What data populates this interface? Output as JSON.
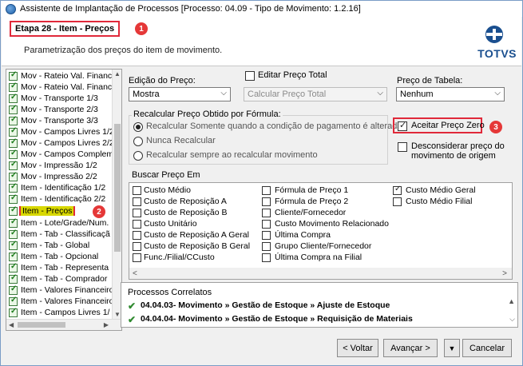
{
  "window": {
    "title": "Assistente de Implantação de Processos [Processo: 04.09 - Tipo de Movimento: 1.2.16]"
  },
  "header": {
    "step_title": "Etapa 28 - Item - Preços",
    "subtitle": "Parametrização dos preços do item de movimento.",
    "badge1": "1",
    "logo_text": "TOTVS"
  },
  "tree": {
    "items": [
      "Mov - Rateio Val. Financ",
      "Mov - Rateio Val. Financ",
      "Mov - Transporte 1/3",
      "Mov - Transporte 2/3",
      "Mov - Transporte 3/3",
      "Mov - Campos Livres 1/2",
      "Mov - Campos Livres 2/2",
      "Mov - Campos Compleme",
      "Mov - Impressão 1/2",
      "Mov - Impressão 2/2",
      "Item - Identificação 1/2",
      "Item - Identificação 2/2",
      "Item - Preços",
      "Item - Lote/Grade/Num.",
      "Item - Tab - Classificaçã",
      "Item - Tab - Global",
      "Item - Tab - Opcional",
      "Item - Tab - Representa",
      "Item - Tab - Comprador",
      "Item - Valores Financeiro",
      "Item - Valores Financeiro",
      "Item - Campos Livres 1/"
    ],
    "badge2": "2"
  },
  "form": {
    "edicao_label": "Edição do Preço:",
    "edicao_value": "Mostra",
    "editar_total_label": "Editar Preço Total",
    "calcular_value": "Calcular Preço Total",
    "preco_tabela_label": "Preço de Tabela:",
    "preco_tabela_value": "Nenhum",
    "recalcular_group": "Recalcular Preço Obtido por Fórmula:",
    "radio1": "Recalcular Somente quando a condição de pagamento é alterada",
    "radio2": "Nunca Recalcular",
    "radio3": "Recalcular sempre ao recalcular movimento",
    "aceitar_label": "Aceitar Preço Zero",
    "badge3": "3",
    "desconsiderar_label_1": "Desconsiderar preço do",
    "desconsiderar_label_2": "movimento de origem"
  },
  "buscar": {
    "group_title": "Buscar Preço Em",
    "col1": [
      "Custo Médio",
      "Custo de Reposição A",
      "Custo de Reposição B",
      "Custo Unitário",
      "Custo de Reposição A Geral",
      "Custo de Reposição B Geral",
      "Func./Filial/CCusto"
    ],
    "col2": [
      "Fórmula de Preço 1",
      "Fórmula de Preço 2",
      "Cliente/Fornecedor",
      "Custo Movimento Relacionado",
      "Última Compra",
      "Grupo Cliente/Fornecedor",
      "Última Compra na Filial"
    ],
    "col3": [
      "Custo Médio Geral",
      "Custo Médio Filial"
    ]
  },
  "related": {
    "title": "Processos Correlatos",
    "row1_code": "04.04.03",
    "row1_text": " - Movimento » Gestão de Estoque » Ajuste de Estoque",
    "row2_code": "04.04.04",
    "row2_text": " - Movimento » Gestão de Estoque » Requisição de Materiais"
  },
  "buttons": {
    "back": "< Voltar",
    "next": "Avançar >",
    "dropdown": "▼",
    "cancel": "Cancelar"
  },
  "colors": {
    "highlight": "#e0293a",
    "selected_item_bg": "#d8d800",
    "brand": "#1a4f8f"
  }
}
